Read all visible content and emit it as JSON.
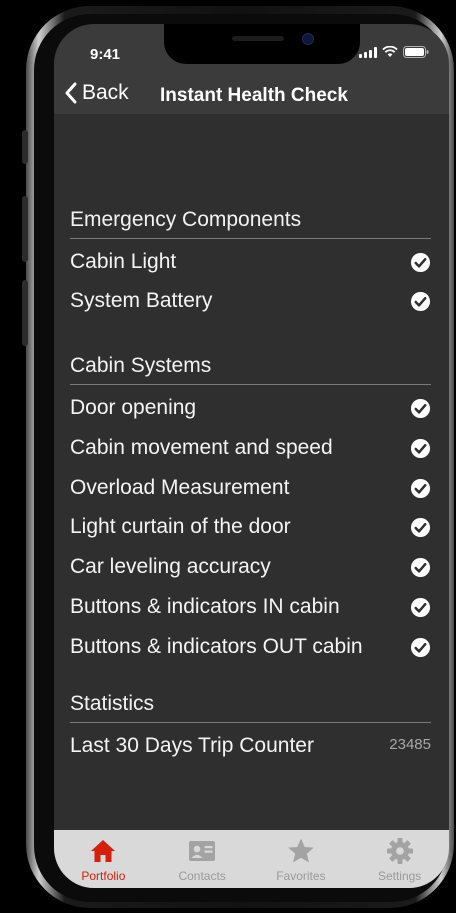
{
  "status_bar": {
    "time": "9:41"
  },
  "nav": {
    "back_label": "Back",
    "title": "Instant Health Check"
  },
  "sections": [
    {
      "title": "Emergency Components",
      "items": [
        {
          "label": "Cabin Light",
          "status": "ok"
        },
        {
          "label": "System Battery",
          "status": "ok"
        }
      ]
    },
    {
      "title": "Cabin Systems",
      "items": [
        {
          "label": "Door opening",
          "status": "ok"
        },
        {
          "label": "Cabin movement and speed",
          "status": "ok"
        },
        {
          "label": "Overload Measurement",
          "status": "ok"
        },
        {
          "label": "Light curtain of the door",
          "status": "ok"
        },
        {
          "label": "Car leveling accuracy",
          "status": "ok"
        },
        {
          "label": "Buttons & indicators IN cabin",
          "status": "ok"
        },
        {
          "label": "Buttons & indicators OUT cabin",
          "status": "ok"
        }
      ]
    },
    {
      "title": "Statistics",
      "items": [
        {
          "label": "Last 30 Days Trip Counter",
          "value": "23485"
        }
      ]
    }
  ],
  "tab_bar": {
    "active": "portfolio",
    "tabs": [
      {
        "label": "Portfolio",
        "icon": "home-icon"
      },
      {
        "label": "Contacts",
        "icon": "contact-card-icon"
      },
      {
        "label": "Favorites",
        "icon": "star-icon"
      },
      {
        "label": "Settings",
        "icon": "gear-icon"
      }
    ]
  },
  "colors": {
    "accent": "#d41f0b",
    "background": "#2f2f2f",
    "tab_bar_bg": "#d9d9d9"
  }
}
